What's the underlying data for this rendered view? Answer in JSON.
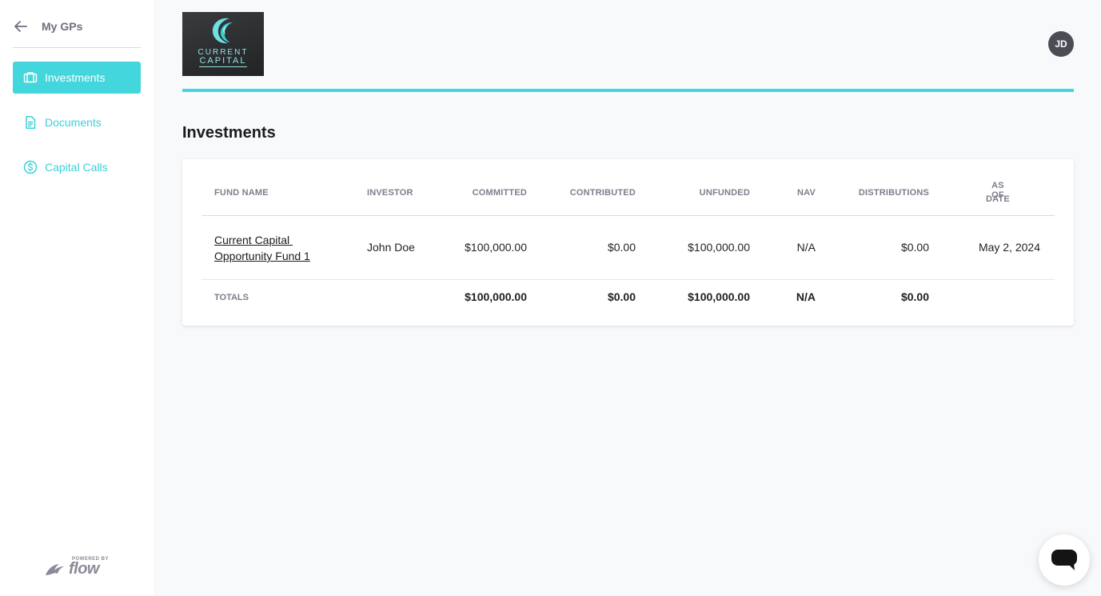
{
  "sidebar": {
    "back_label": "My GPs",
    "items": [
      {
        "label": "Investments",
        "icon": "briefcase-icon",
        "active": true
      },
      {
        "label": "Documents",
        "icon": "document-icon",
        "active": false
      },
      {
        "label": "Capital Calls",
        "icon": "dollar-circle-icon",
        "active": false
      }
    ],
    "powered_by": "POWERED BY",
    "brand": "flow"
  },
  "header": {
    "logo_line1": "CURRENT",
    "logo_line2": "CAPITAL",
    "avatar_initials": "JD"
  },
  "page": {
    "title": "Investments"
  },
  "table": {
    "columns": [
      "FUND NAME",
      "INVESTOR",
      "COMMITTED",
      "CONTRIBUTED",
      "UNFUNDED",
      "NAV",
      "DISTRIBUTIONS",
      "AS OF",
      "DATE"
    ],
    "rows": [
      {
        "fund_name_line1": "Current Capital ",
        "fund_name_line2": "Opportunity Fund 1",
        "investor": "John Doe",
        "committed": "$100,000.00",
        "contributed": "$0.00",
        "unfunded": "$100,000.00",
        "nav": "N/A",
        "distributions": "$0.00",
        "as_of_date": "May 2, 2024"
      }
    ],
    "totals": {
      "label": "TOTALS",
      "committed": "$100,000.00",
      "contributed": "$0.00",
      "unfunded": "$100,000.00",
      "nav": "N/A",
      "distributions": "$0.00"
    }
  },
  "colors": {
    "accent": "#43d6dc",
    "sidebar_bg": "#ffffff",
    "page_bg": "#f8f9fb",
    "avatar_bg": "#4b4c55"
  }
}
